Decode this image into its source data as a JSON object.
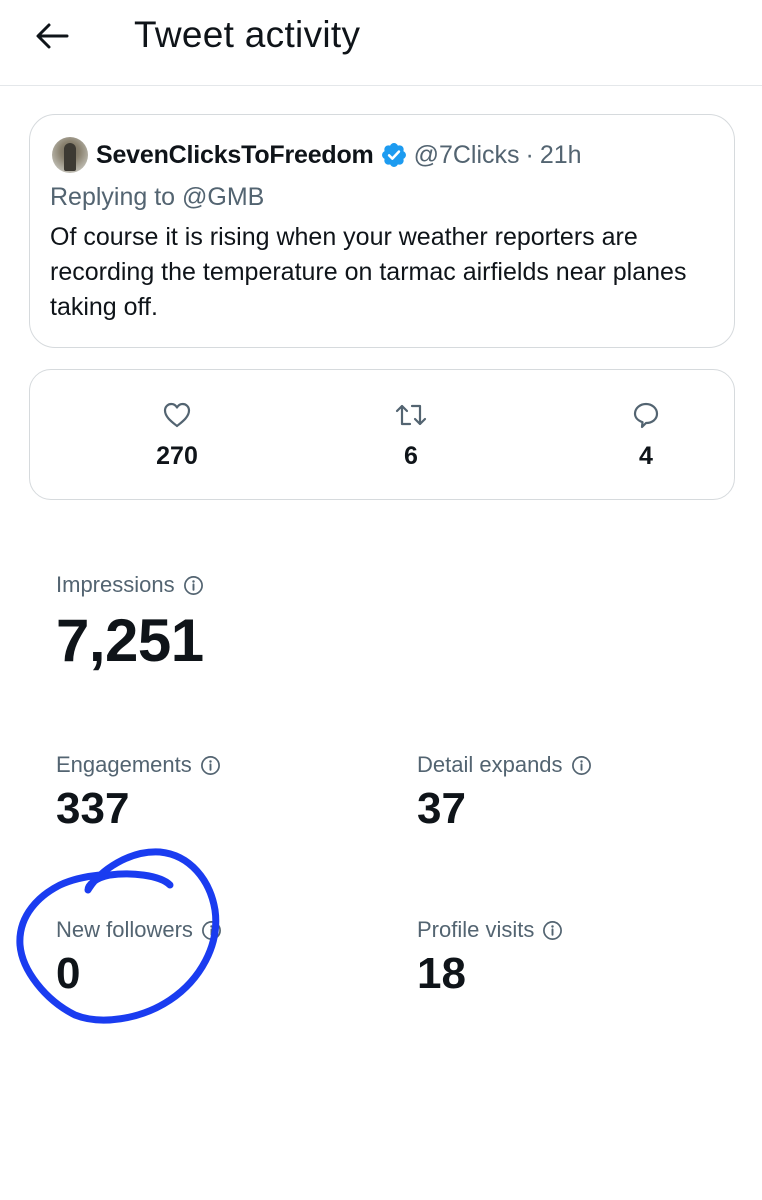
{
  "header": {
    "title": "Tweet activity",
    "back_icon": "arrow-left-icon"
  },
  "tweet": {
    "display_name": "SevenClicksToFreedom",
    "verified": true,
    "verified_color": "#1d9bf0",
    "handle": "@7Clicks",
    "separator": "·",
    "time": "21h",
    "replying_to": "Replying to @GMB",
    "text": "Of course it is rising when your weather reporters are recording the temperature on tarmac airfields near planes taking off."
  },
  "engagement": {
    "likes": {
      "icon": "heart-icon",
      "value": "270"
    },
    "retweets": {
      "icon": "retweet-icon",
      "value": "6"
    },
    "replies": {
      "icon": "reply-icon",
      "value": "4"
    }
  },
  "stats": {
    "impressions": {
      "label": "Impressions",
      "value": "7,251"
    },
    "engagements": {
      "label": "Engagements",
      "value": "337"
    },
    "detail_expands": {
      "label": "Detail expands",
      "value": "37"
    },
    "new_followers": {
      "label": "New followers",
      "value": "0"
    },
    "profile_visits": {
      "label": "Profile visits",
      "value": "18"
    }
  },
  "annotation": {
    "type": "hand-drawn circle around New followers",
    "color": "#1a3cf0"
  },
  "colors": {
    "text_primary": "#0f1419",
    "text_secondary": "#536471",
    "border": "#d6dadd"
  }
}
